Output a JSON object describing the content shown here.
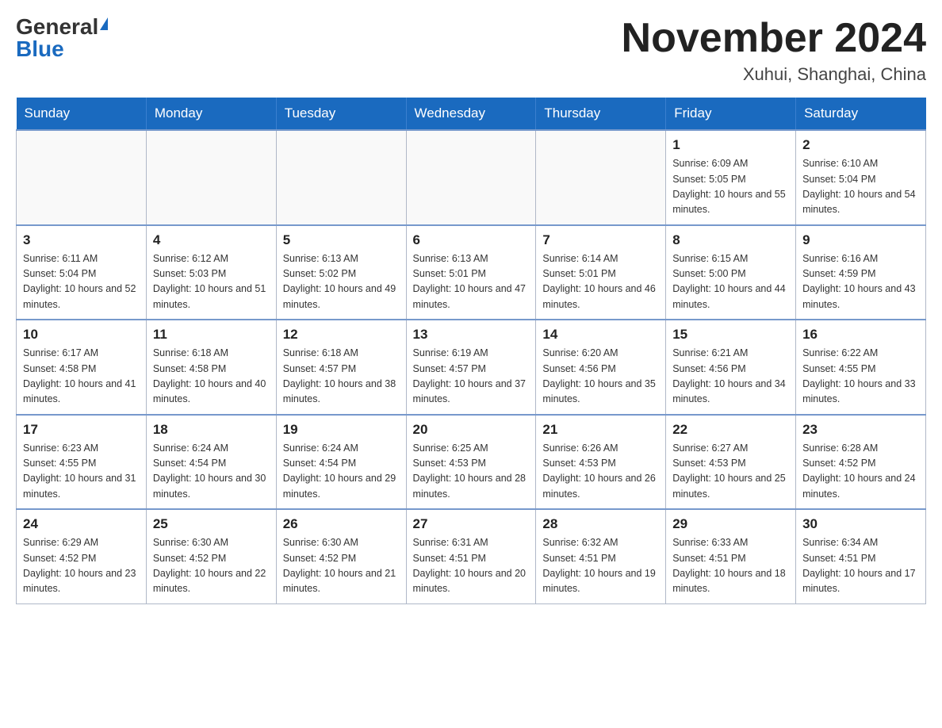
{
  "header": {
    "logo_general": "General",
    "logo_blue": "Blue",
    "title": "November 2024",
    "subtitle": "Xuhui, Shanghai, China"
  },
  "days_of_week": [
    "Sunday",
    "Monday",
    "Tuesday",
    "Wednesday",
    "Thursday",
    "Friday",
    "Saturday"
  ],
  "weeks": [
    [
      {
        "day": "",
        "info": ""
      },
      {
        "day": "",
        "info": ""
      },
      {
        "day": "",
        "info": ""
      },
      {
        "day": "",
        "info": ""
      },
      {
        "day": "",
        "info": ""
      },
      {
        "day": "1",
        "info": "Sunrise: 6:09 AM\nSunset: 5:05 PM\nDaylight: 10 hours and 55 minutes."
      },
      {
        "day": "2",
        "info": "Sunrise: 6:10 AM\nSunset: 5:04 PM\nDaylight: 10 hours and 54 minutes."
      }
    ],
    [
      {
        "day": "3",
        "info": "Sunrise: 6:11 AM\nSunset: 5:04 PM\nDaylight: 10 hours and 52 minutes."
      },
      {
        "day": "4",
        "info": "Sunrise: 6:12 AM\nSunset: 5:03 PM\nDaylight: 10 hours and 51 minutes."
      },
      {
        "day": "5",
        "info": "Sunrise: 6:13 AM\nSunset: 5:02 PM\nDaylight: 10 hours and 49 minutes."
      },
      {
        "day": "6",
        "info": "Sunrise: 6:13 AM\nSunset: 5:01 PM\nDaylight: 10 hours and 47 minutes."
      },
      {
        "day": "7",
        "info": "Sunrise: 6:14 AM\nSunset: 5:01 PM\nDaylight: 10 hours and 46 minutes."
      },
      {
        "day": "8",
        "info": "Sunrise: 6:15 AM\nSunset: 5:00 PM\nDaylight: 10 hours and 44 minutes."
      },
      {
        "day": "9",
        "info": "Sunrise: 6:16 AM\nSunset: 4:59 PM\nDaylight: 10 hours and 43 minutes."
      }
    ],
    [
      {
        "day": "10",
        "info": "Sunrise: 6:17 AM\nSunset: 4:58 PM\nDaylight: 10 hours and 41 minutes."
      },
      {
        "day": "11",
        "info": "Sunrise: 6:18 AM\nSunset: 4:58 PM\nDaylight: 10 hours and 40 minutes."
      },
      {
        "day": "12",
        "info": "Sunrise: 6:18 AM\nSunset: 4:57 PM\nDaylight: 10 hours and 38 minutes."
      },
      {
        "day": "13",
        "info": "Sunrise: 6:19 AM\nSunset: 4:57 PM\nDaylight: 10 hours and 37 minutes."
      },
      {
        "day": "14",
        "info": "Sunrise: 6:20 AM\nSunset: 4:56 PM\nDaylight: 10 hours and 35 minutes."
      },
      {
        "day": "15",
        "info": "Sunrise: 6:21 AM\nSunset: 4:56 PM\nDaylight: 10 hours and 34 minutes."
      },
      {
        "day": "16",
        "info": "Sunrise: 6:22 AM\nSunset: 4:55 PM\nDaylight: 10 hours and 33 minutes."
      }
    ],
    [
      {
        "day": "17",
        "info": "Sunrise: 6:23 AM\nSunset: 4:55 PM\nDaylight: 10 hours and 31 minutes."
      },
      {
        "day": "18",
        "info": "Sunrise: 6:24 AM\nSunset: 4:54 PM\nDaylight: 10 hours and 30 minutes."
      },
      {
        "day": "19",
        "info": "Sunrise: 6:24 AM\nSunset: 4:54 PM\nDaylight: 10 hours and 29 minutes."
      },
      {
        "day": "20",
        "info": "Sunrise: 6:25 AM\nSunset: 4:53 PM\nDaylight: 10 hours and 28 minutes."
      },
      {
        "day": "21",
        "info": "Sunrise: 6:26 AM\nSunset: 4:53 PM\nDaylight: 10 hours and 26 minutes."
      },
      {
        "day": "22",
        "info": "Sunrise: 6:27 AM\nSunset: 4:53 PM\nDaylight: 10 hours and 25 minutes."
      },
      {
        "day": "23",
        "info": "Sunrise: 6:28 AM\nSunset: 4:52 PM\nDaylight: 10 hours and 24 minutes."
      }
    ],
    [
      {
        "day": "24",
        "info": "Sunrise: 6:29 AM\nSunset: 4:52 PM\nDaylight: 10 hours and 23 minutes."
      },
      {
        "day": "25",
        "info": "Sunrise: 6:30 AM\nSunset: 4:52 PM\nDaylight: 10 hours and 22 minutes."
      },
      {
        "day": "26",
        "info": "Sunrise: 6:30 AM\nSunset: 4:52 PM\nDaylight: 10 hours and 21 minutes."
      },
      {
        "day": "27",
        "info": "Sunrise: 6:31 AM\nSunset: 4:51 PM\nDaylight: 10 hours and 20 minutes."
      },
      {
        "day": "28",
        "info": "Sunrise: 6:32 AM\nSunset: 4:51 PM\nDaylight: 10 hours and 19 minutes."
      },
      {
        "day": "29",
        "info": "Sunrise: 6:33 AM\nSunset: 4:51 PM\nDaylight: 10 hours and 18 minutes."
      },
      {
        "day": "30",
        "info": "Sunrise: 6:34 AM\nSunset: 4:51 PM\nDaylight: 10 hours and 17 minutes."
      }
    ]
  ]
}
